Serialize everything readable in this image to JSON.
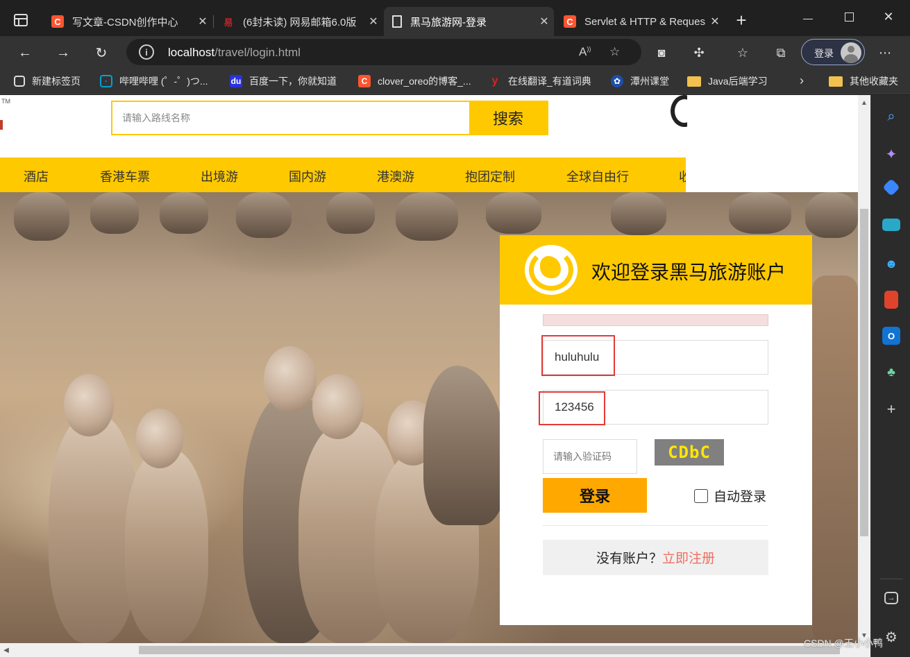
{
  "browser": {
    "tabs": [
      {
        "title": "写文章-CSDN创作中心",
        "favicon": "csdn-icon",
        "active": false
      },
      {
        "title": "(6封未读) 网易邮箱6.0版",
        "favicon": "netease-mail-icon",
        "active": false
      },
      {
        "title": "黑马旅游网-登录",
        "favicon": "page-icon",
        "active": true
      },
      {
        "title": "Servlet & HTTP & Reques",
        "favicon": "csdn-icon",
        "active": false
      }
    ],
    "url_host": "localhost",
    "url_path": "/travel/login.html",
    "profile_label": "登录",
    "window_controls": [
      "minimize",
      "maximize",
      "close"
    ]
  },
  "favorites": [
    {
      "label": "新建标签页",
      "icon": "new-tab-icon"
    },
    {
      "label": "哔哩哔哩 (゜-゜)つ...",
      "icon": "bilibili-icon"
    },
    {
      "label": "百度一下，你就知道",
      "icon": "baidu-icon"
    },
    {
      "label": "clover_oreo的博客_...",
      "icon": "csdn-icon"
    },
    {
      "label": "在线翻译_有道词典",
      "icon": "youdao-icon"
    },
    {
      "label": "潭州课堂",
      "icon": "tanzhou-icon"
    },
    {
      "label": "Java后端学习",
      "icon": "folder-icon"
    },
    {
      "label": "其他收藏夹",
      "icon": "folder-icon"
    }
  ],
  "site": {
    "trademark": "TM",
    "search_placeholder": "请输入路线名称",
    "search_button": "搜索",
    "nav": [
      "酒店",
      "香港车票",
      "出境游",
      "国内游",
      "港澳游",
      "抱团定制",
      "全球自由行",
      "收"
    ]
  },
  "login": {
    "title": "欢迎登录黑马旅游账户",
    "username_value": "huluhulu",
    "password_value": "123456",
    "captcha_placeholder": "请输入验证码",
    "captcha_text": "CDbC",
    "login_button": "登录",
    "auto_login_label": "自动登录",
    "register_prompt": "没有账户？",
    "register_link": "立即注册"
  },
  "watermark": "CSDN @王小小鸭",
  "colors": {
    "accent_yellow": "#ffc900",
    "login_button": "#ffa800",
    "register_link": "#ee6f62",
    "error_bar": "#f4dede",
    "highlight_box": "#e53935"
  }
}
